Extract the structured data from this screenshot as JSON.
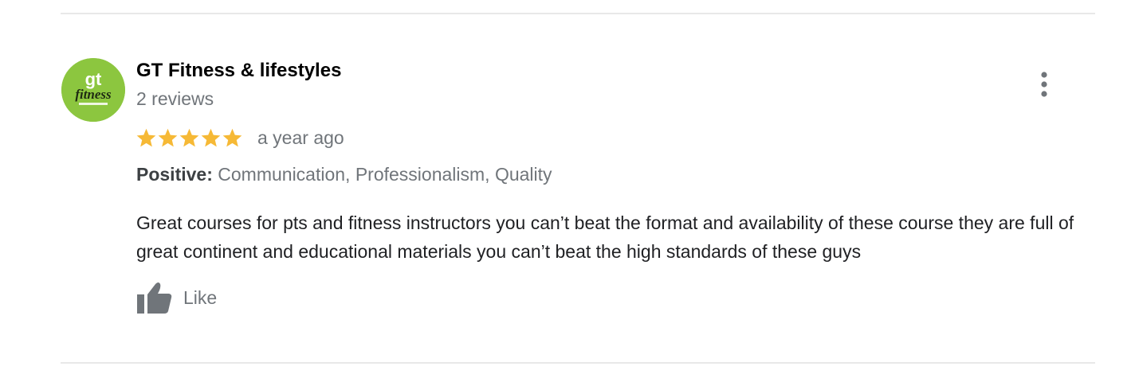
{
  "review": {
    "reviewer_name": "GT Fitness & lifestyles",
    "review_count": "2 reviews",
    "avatar": {
      "icon": "gt-fitness-logo",
      "logo_text": "gt",
      "logo_subtext": "fitness",
      "bg_color": "#8cc63f"
    },
    "rating": 5,
    "rating_max": 5,
    "star_color": "#f6b936",
    "date": "a year ago",
    "highlights": {
      "label": "Positive:",
      "values": "Communication, Professionalism, Quality"
    },
    "text": "Great courses for pts and fitness instructors you can’t beat the format and availability of these course they are full of great continent and educational materials you can’t beat the high standards of these guys",
    "like_label": "Like",
    "menu_icon": "more-vert-icon"
  }
}
